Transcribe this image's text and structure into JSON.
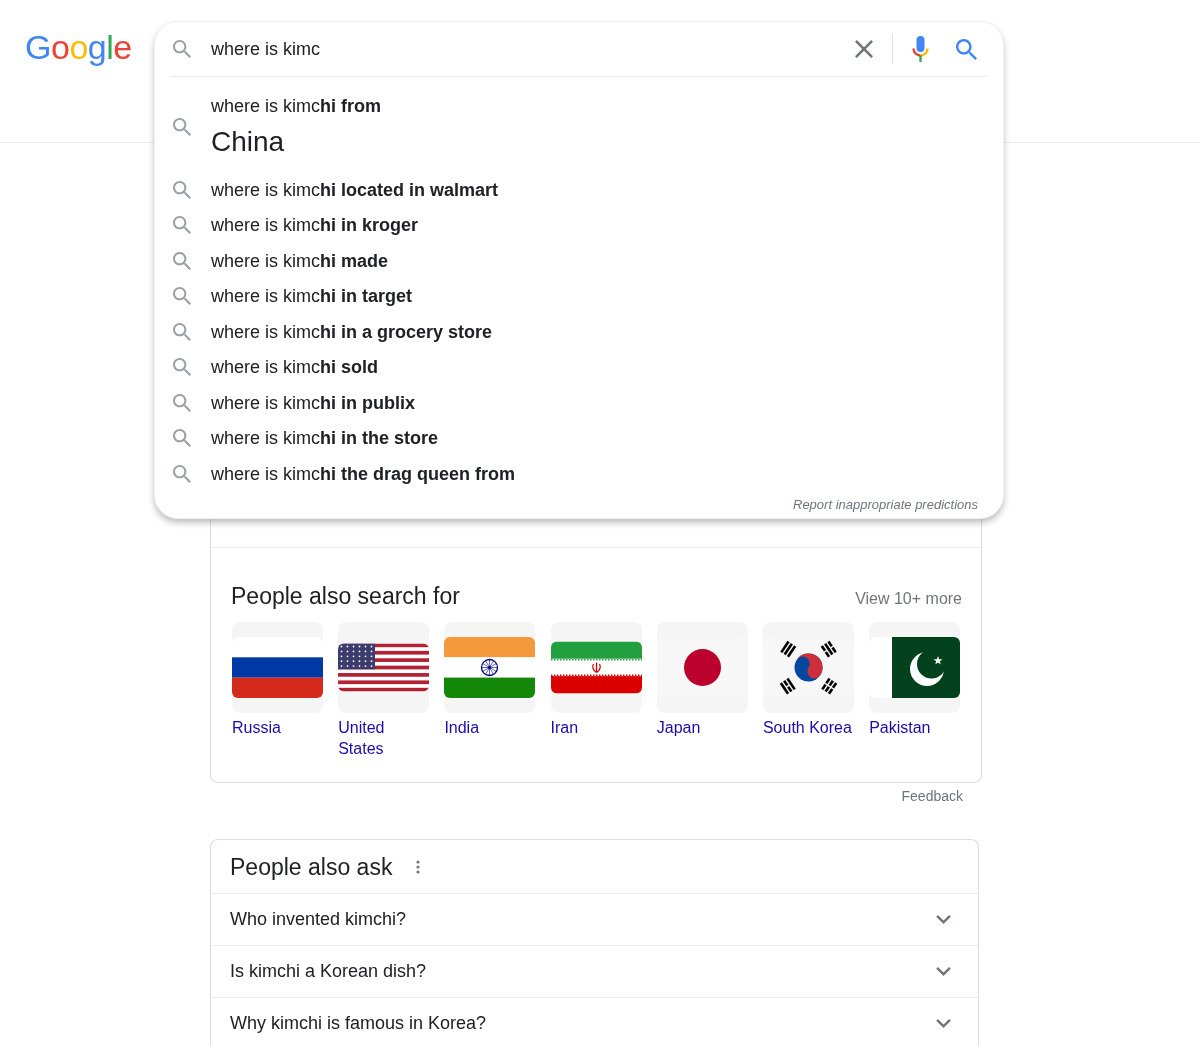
{
  "header": {
    "logo": "Google"
  },
  "search": {
    "query": "where is kimc",
    "suggestions": [
      {
        "kind": "entity",
        "text": "where is kimc**hi from**",
        "subtitle": "China"
      },
      {
        "kind": "query",
        "text": "where is kimc**hi located in walmart**"
      },
      {
        "kind": "query",
        "text": "where is kimc**hi in kroger**"
      },
      {
        "kind": "query",
        "text": "where is kimc**hi made**"
      },
      {
        "kind": "query",
        "text": "where is kimc**hi in target**"
      },
      {
        "kind": "query",
        "text": "where is kimc**hi in a grocery store**"
      },
      {
        "kind": "query",
        "text": "where is kimc**hi sold**"
      },
      {
        "kind": "query",
        "text": "where is kimc**hi in publix**"
      },
      {
        "kind": "query",
        "text": "where is kimc**hi in the store**"
      },
      {
        "kind": "query",
        "text": "where is kimc**hi the drag queen from**"
      }
    ],
    "report_link": "Report inappropriate predictions"
  },
  "people_also_search": {
    "title": "People also search for",
    "more_link": "View 10+ more",
    "items": [
      {
        "name": "Russia"
      },
      {
        "name": "United States"
      },
      {
        "name": "India"
      },
      {
        "name": "Iran"
      },
      {
        "name": "Japan"
      },
      {
        "name": "South Korea"
      },
      {
        "name": "Pakistan"
      }
    ]
  },
  "feedback": "Feedback",
  "people_also_ask": {
    "title": "People also ask",
    "questions": [
      {
        "text": "Who invented kimchi?",
        "expanded": false
      },
      {
        "text": "Is kimchi a Korean dish?",
        "expanded": false
      },
      {
        "text": "Why kimchi is famous in Korea?",
        "expanded": false
      }
    ]
  }
}
